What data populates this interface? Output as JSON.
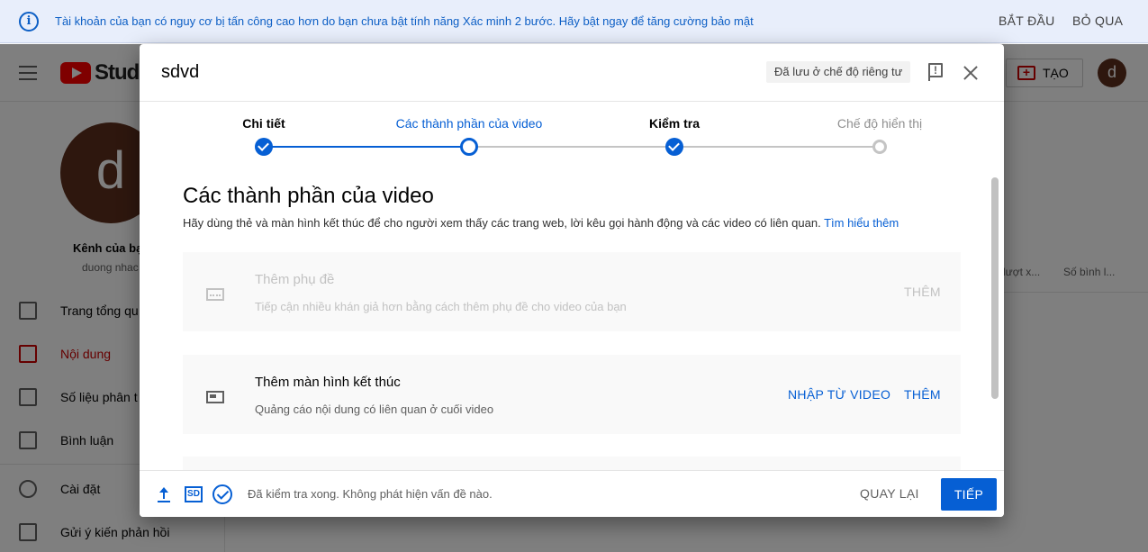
{
  "banner": {
    "message": "Tài khoản của bạn có nguy cơ bị tấn công cao hơn do bạn chưa bật tính năng Xác minh 2 bước. Hãy bật ngay để tăng cường bảo mật",
    "start_label": "BẮT ĐẦU",
    "skip_label": "BỎ QUA"
  },
  "app": {
    "logo_text": "Studio",
    "create_label": "TẠO",
    "avatar_letter": "d",
    "channel": {
      "avatar_letter": "d",
      "name": "Kênh của bạ",
      "handle": "duong nhac"
    },
    "nav": [
      {
        "label": "Trang tổng qu",
        "active": false
      },
      {
        "label": "Nội dung",
        "active": true
      },
      {
        "label": "Số liệu phân t",
        "active": false
      },
      {
        "label": "Bình luận",
        "active": false
      },
      {
        "label": "Cài đặt",
        "active": false
      },
      {
        "label": "Gửi ý kiến phản hồi",
        "active": false
      }
    ],
    "columns": [
      "lượt x...",
      "Số bình l..."
    ]
  },
  "dialog": {
    "title": "sdvd",
    "saved_chip": "Đã lưu ở chế độ riêng tư",
    "steps": [
      {
        "label": "Chi tiết",
        "state": "done"
      },
      {
        "label": "Các thành phần của video",
        "state": "current"
      },
      {
        "label": "Kiểm tra",
        "state": "done"
      },
      {
        "label": "Chế độ hiển thị",
        "state": "todo"
      }
    ],
    "section": {
      "title": "Các thành phần của video",
      "description": "Hãy dùng thẻ và màn hình kết thúc để cho người xem thấy các trang web, lời kêu gọi hành động và các video có liên quan.",
      "learn_more": "Tìm hiểu thêm"
    },
    "cards": [
      {
        "title": "Thêm phụ đề",
        "description": "Tiếp cận nhiều khán giả hơn bằng cách thêm phụ đề cho video của bạn",
        "add_label": "THÊM",
        "disabled": true
      },
      {
        "title": "Thêm màn hình kết thúc",
        "description": "Quảng cáo nội dung có liên quan ở cuối video",
        "import_label": "NHẬP TỪ VIDEO",
        "add_label": "THÊM",
        "disabled": false
      }
    ],
    "footer": {
      "sd_label": "SD",
      "status": "Đã kiểm tra xong. Không phát hiện vấn đề nào.",
      "back_label": "QUAY LẠI",
      "next_label": "TIẾP"
    }
  },
  "colors": {
    "accent": "#065fd4",
    "brand_red": "#ff0000",
    "banner_bg": "#e8eefb"
  }
}
